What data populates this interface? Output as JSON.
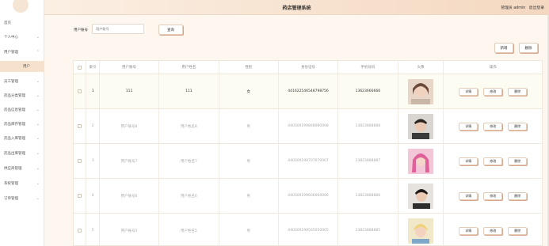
{
  "header": {
    "title": "药店管理系统",
    "user_label": "管理员 admin",
    "logout": "退出登录"
  },
  "sidebar": {
    "items": [
      {
        "label": "首页"
      },
      {
        "label": "个人中心"
      },
      {
        "label": "用户管理"
      },
      {
        "label": "用户"
      },
      {
        "label": "员工管理"
      },
      {
        "label": "药品分类管理"
      },
      {
        "label": "药品信息管理"
      },
      {
        "label": "药品库存管理"
      },
      {
        "label": "药品入库管理"
      },
      {
        "label": "药品出库管理"
      },
      {
        "label": "供应商管理"
      },
      {
        "label": "系统管理"
      },
      {
        "label": "订单管理"
      }
    ]
  },
  "search": {
    "label": "用户账号",
    "placeholder": "用户账号",
    "button": "查询"
  },
  "toolbar": {
    "add": "新增",
    "delete": "删除"
  },
  "table": {
    "columns": [
      "索引",
      "用户账号",
      "用户姓名",
      "性别",
      "身份证号",
      "手机号码",
      "头像",
      "操作"
    ],
    "rows": [
      {
        "index": "1",
        "account": "111",
        "name": "111",
        "gender": "女",
        "id_card": "441622546548798756",
        "phone": "13623666666"
      },
      {
        "index": "2",
        "account": "用户账号8",
        "name": "用户姓名8",
        "gender": "男",
        "id_card": "440300199808080008",
        "phone": "13823888888"
      },
      {
        "index": "3",
        "account": "用户账号7",
        "name": "用户姓名7",
        "gender": "男",
        "id_card": "440300199707070007",
        "phone": "13823888887"
      },
      {
        "index": "4",
        "account": "用户账号6",
        "name": "用户姓名6",
        "gender": "男",
        "id_card": "440300199606060006",
        "phone": "13823888886"
      },
      {
        "index": "5",
        "account": "用户账号5",
        "name": "用户姓名5",
        "gender": "男",
        "id_card": "440300199505050005",
        "phone": "13823888885"
      }
    ],
    "row_actions": {
      "detail": "详情",
      "edit": "修改",
      "delete": "删除"
    }
  },
  "colors": {
    "accent": "#d9a88c",
    "header_bg": "#f4d8c0",
    "active_menu": "#f6e1cd"
  }
}
